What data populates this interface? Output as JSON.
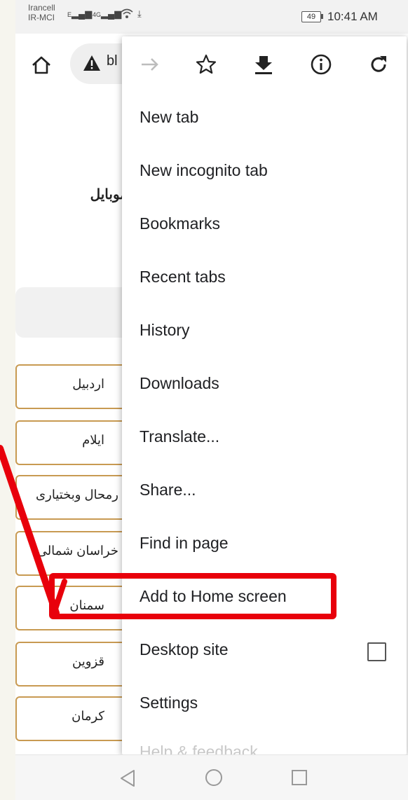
{
  "status_bar": {
    "carrier_top": "Irancell",
    "carrier_bottom": "IR-MCI",
    "signal1": "E",
    "signal2": "4G",
    "battery": "49",
    "time": "10:41 AM"
  },
  "toolbar": {
    "url_fragment": "bl"
  },
  "page": {
    "heading": "موبایل",
    "provinces": [
      "اردبیل",
      "ایلام",
      "رمحال وبختیاری",
      "خراسان شمالی",
      "سمنان",
      "قزوین",
      "کرمان"
    ]
  },
  "menu": {
    "top_icons": [
      "forward-arrow-icon",
      "star-bookmark-icon",
      "download-icon",
      "info-icon",
      "refresh-icon"
    ],
    "items": [
      {
        "label": "New tab"
      },
      {
        "label": "New incognito tab"
      },
      {
        "label": "Bookmarks"
      },
      {
        "label": "Recent tabs"
      },
      {
        "label": "History"
      },
      {
        "label": "Downloads"
      },
      {
        "label": "Translate..."
      },
      {
        "label": "Share..."
      },
      {
        "label": "Find in page"
      },
      {
        "label": "Add to Home screen"
      },
      {
        "label": "Desktop site",
        "checked": false
      },
      {
        "label": "Settings"
      },
      {
        "label": "Help & feedback"
      }
    ]
  },
  "annotation": {
    "color": "#e8000b",
    "highlighted_item": "Add to Home screen"
  },
  "navbar": {
    "buttons": [
      "back-triangle-icon",
      "home-circle-icon",
      "recents-square-icon"
    ]
  }
}
